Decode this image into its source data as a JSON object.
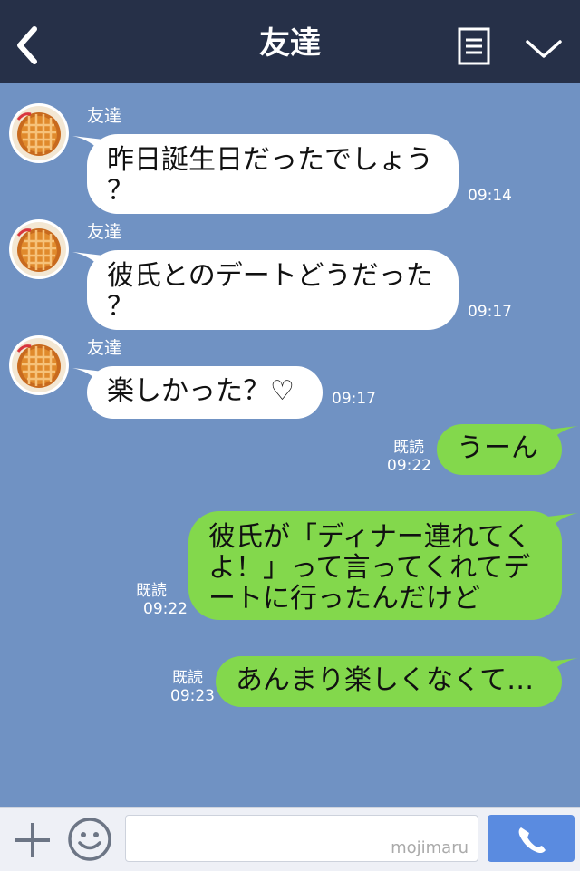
{
  "header": {
    "title": "友達"
  },
  "messages": [
    {
      "side": "left",
      "name": "友達",
      "lines": [
        "昨日誕生日だったでしょう",
        "？"
      ],
      "time": "09:14"
    },
    {
      "side": "left",
      "name": "友達",
      "lines": [
        "彼氏とのデートどうだった",
        "？"
      ],
      "time": "09:17"
    },
    {
      "side": "left",
      "name": "友達",
      "lines": [
        "楽しかった？♡"
      ],
      "time": "09:17"
    },
    {
      "side": "right",
      "read": "既読",
      "lines": [
        "うーん"
      ],
      "time": "09:22"
    },
    {
      "side": "right",
      "read": "既読",
      "lines": [
        "彼氏が「ディナー連れてく",
        "よ！」って言ってくれてデ",
        "ートに行ったんだけど"
      ],
      "time": "09:22"
    },
    {
      "side": "right",
      "read": "既読",
      "lines": [
        "あんまり楽しくなくて…"
      ],
      "time": "09:23"
    }
  ],
  "footer": {
    "input_value": "",
    "watermark": "mojimaru"
  },
  "colors": {
    "header": "#263048",
    "background": "#7092c3",
    "right_bubble": "#83d84c",
    "left_bubble": "#ffffff",
    "call_button": "#5a8be0"
  },
  "icons": {
    "back": "chevron-left-icon",
    "menu": "menu-icon",
    "collapse": "chevron-down-icon",
    "add": "plus-icon",
    "sticker": "smiley-icon",
    "call": "phone-icon",
    "avatar": "pie-avatar"
  }
}
